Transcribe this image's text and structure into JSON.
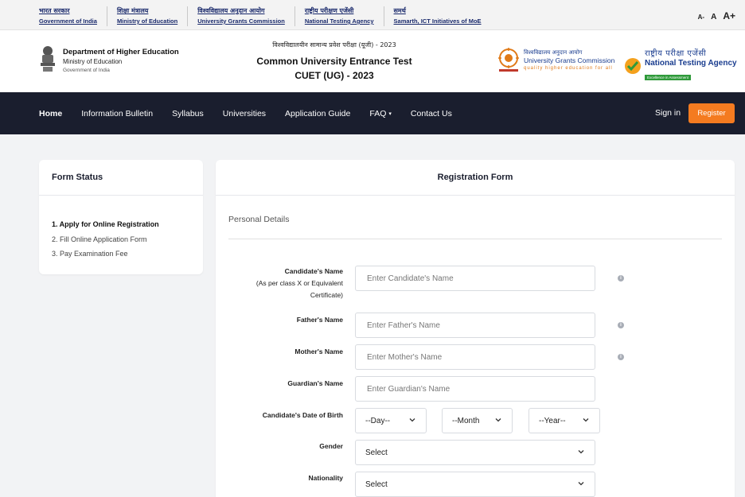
{
  "top_links": [
    {
      "hi": "भारत सरकार",
      "en": "Government of India"
    },
    {
      "hi": "शिक्षा मंत्रालय",
      "en": "Ministry of Education"
    },
    {
      "hi": "विश्वविद्यालय अनुदान आयोग",
      "en": "University Grants Commission"
    },
    {
      "hi": "राष्ट्रीय परीक्षण एजेंसी",
      "en": "National Testing Agency"
    },
    {
      "hi": "समर्थ",
      "en": "Samarth, ICT Initiatives of MoE"
    }
  ],
  "font_sizer": {
    "small": "A-",
    "medium": "A",
    "large": "A+"
  },
  "header": {
    "dept_name": "Department of Higher Education",
    "ministry": "Ministry of Education",
    "government": "Government of India",
    "exam_hindi": "विश्वविद्यालयीन सामान्य प्रवेश परीक्षा (यूजी) - 2023",
    "exam_name": "Common University Entrance Test",
    "exam_code": "CUET (UG) - 2023",
    "ugc_hindi": "विश्वविद्यालय अनुदान आयोग",
    "ugc_name": "University Grants Commission",
    "ugc_tagline": "quality higher education for all",
    "nta_hindi": "राष्ट्रीय परीक्षा एजेंसी",
    "nta_name": "National Testing Agency",
    "nta_tagline": "Excellence in Assessment"
  },
  "nav": {
    "items": [
      "Home",
      "Information Bulletin",
      "Syllabus",
      "Universities",
      "Application Guide",
      "FAQ",
      "Contact Us"
    ],
    "sign_in": "Sign in",
    "register": "Register",
    "bg": "#1a1e2e",
    "accent": "#f47b20"
  },
  "form_status": {
    "title": "Form Status",
    "steps": [
      "1. Apply for Online Registration",
      "2. Fill Online Application Form",
      "3. Pay Examination Fee"
    ]
  },
  "form": {
    "title": "Registration Form",
    "section": "Personal Details",
    "candidate_name_label_1": "Candidate's Name",
    "candidate_name_label_2": "(As per class X or Equivalent",
    "candidate_name_label_3": "Certificate)",
    "candidate_name_placeholder": "Enter Candidate's Name",
    "father_label": "Father's Name",
    "father_placeholder": "Enter Father's Name",
    "mother_label": "Mother's Name",
    "mother_placeholder": "Enter Mother's Name",
    "guardian_label": "Guardian's Name",
    "guardian_placeholder": "Enter Guardian's Name",
    "dob_label": "Candidate's Date of Birth",
    "dob_day": "--Day--",
    "dob_month": "--Month",
    "dob_year": "--Year--",
    "gender_label": "Gender",
    "gender_value": "Select",
    "nationality_label": "Nationality",
    "nationality_value": "Select"
  }
}
